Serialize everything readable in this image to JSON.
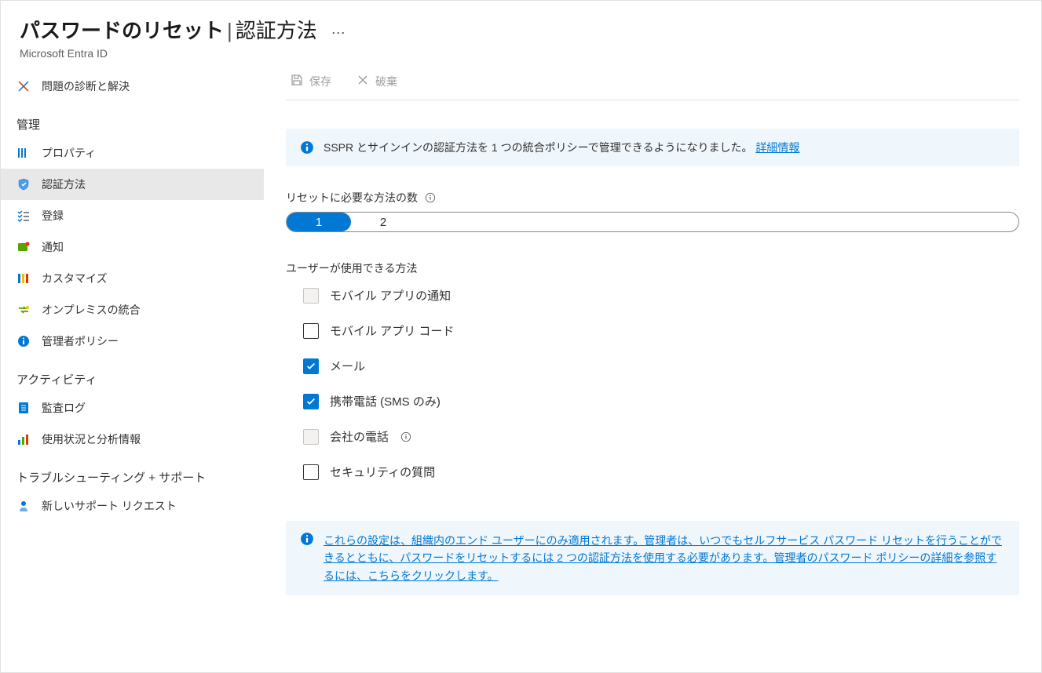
{
  "header": {
    "title": "パスワードのリセット",
    "subtitle": "認証方法",
    "breadcrumb": "Microsoft Entra ID"
  },
  "toolbar": {
    "save": "保存",
    "discard": "破棄"
  },
  "sidebar": {
    "diagnose": "問題の診断と解決",
    "sections": {
      "manage": "管理",
      "activity": "アクティビティ",
      "troubleshoot": "トラブルシューティング + サポート"
    },
    "items": {
      "properties": "プロパティ",
      "authMethods": "認証方法",
      "registration": "登録",
      "notifications": "通知",
      "customize": "カスタマイズ",
      "onprem": "オンプレミスの統合",
      "adminPolicy": "管理者ポリシー",
      "auditLogs": "監査ログ",
      "usage": "使用状況と分析情報",
      "newRequest": "新しいサポート リクエスト"
    }
  },
  "banner1": {
    "text": "SSPR とサインインの認証方法を 1 つの統合ポリシーで管理できるようになりました。",
    "link": "詳細情報"
  },
  "form": {
    "methodsRequiredLabel": "リセットに必要な方法の数",
    "options": {
      "one": "1",
      "two": "2"
    },
    "selectedOption": "1",
    "availableMethodsLabel": "ユーザーが使用できる方法",
    "methods": {
      "mobileAppNotification": "モバイル アプリの通知",
      "mobileAppCode": "モバイル アプリ コード",
      "email": "メール",
      "mobilePhone": "携帯電話 (SMS のみ)",
      "officePhone": "会社の電話",
      "securityQuestions": "セキュリティの質問"
    }
  },
  "banner2": {
    "text": "これらの設定は、組織内のエンド ユーザーにのみ適用されます。管理者は、いつでもセルフサービス パスワード リセットを行うことができるとともに、パスワードをリセットするには 2 つの認証方法を使用する必要があります。管理者のパスワード ポリシーの詳細を参照するには、こちらをクリックします。"
  }
}
